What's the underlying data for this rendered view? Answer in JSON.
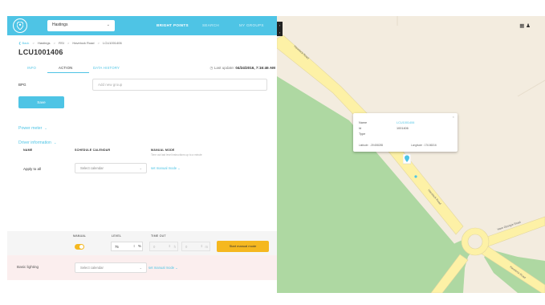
{
  "header": {
    "area_select": "Hastings",
    "nav": [
      "BRIGHT POINTS",
      "SEARCH",
      "MY GROUPS"
    ]
  },
  "breadcrumb": {
    "back": "Back",
    "items": [
      "Hastings",
      "RSI",
      "Havelock Road",
      "LCU1001406"
    ]
  },
  "title": "LCU1001406",
  "tabs": [
    "INFO",
    "ACTION",
    "DATA HISTORY"
  ],
  "last_update": {
    "label": "Last update:",
    "value": "04/24/2016, 7:16:46 AM"
  },
  "bpg": {
    "label": "BPG",
    "placeholder": "Add new group"
  },
  "save_label": "Save",
  "power_meter": "Power meter",
  "driver_information": "Driver information",
  "columns": {
    "name": "NAME",
    "schedule": "SCHEDULE CALENDAR",
    "manual": "MANUAL MODE",
    "manual_sub": "Time out last level instructions up to a minute"
  },
  "apply_all": {
    "label": "Apply to all",
    "select": "Select calendar",
    "link": "set manual mode"
  },
  "manual_panel": {
    "manual_label": "MANUAL",
    "level_label": "LEVEL",
    "timeout_label": "TIME OUT",
    "level_value": "75",
    "level_unit": "%",
    "timeout_h": "0",
    "timeout_m": "0",
    "timeout_h_unit": "h",
    "timeout_m_unit": "m",
    "start_label": "Start manual mode",
    "toggle_on": true,
    "toggle_color": "#f5b820"
  },
  "basic_lighting": {
    "label": "Basic lighting",
    "select": "Select calendar",
    "link": "set manual mode"
  },
  "map": {
    "road_1": "Havelock Road",
    "road_2": "Havelock Road",
    "road_3": "Hare Georgie Road",
    "road_4": "Havelock Road",
    "info": {
      "name_label": "Name",
      "name_value": "LCU1001406",
      "id_label": "Id",
      "id_value": "1001406",
      "type_label": "Type",
      "latitude": "Latitude : -39.658285",
      "longitude": "Longitude : 176.86316"
    }
  },
  "colors": {
    "accent": "#4ec4e5",
    "warning": "#f5b820",
    "park_green": "#aed8a2",
    "road_yellow": "#fdf1a6"
  }
}
